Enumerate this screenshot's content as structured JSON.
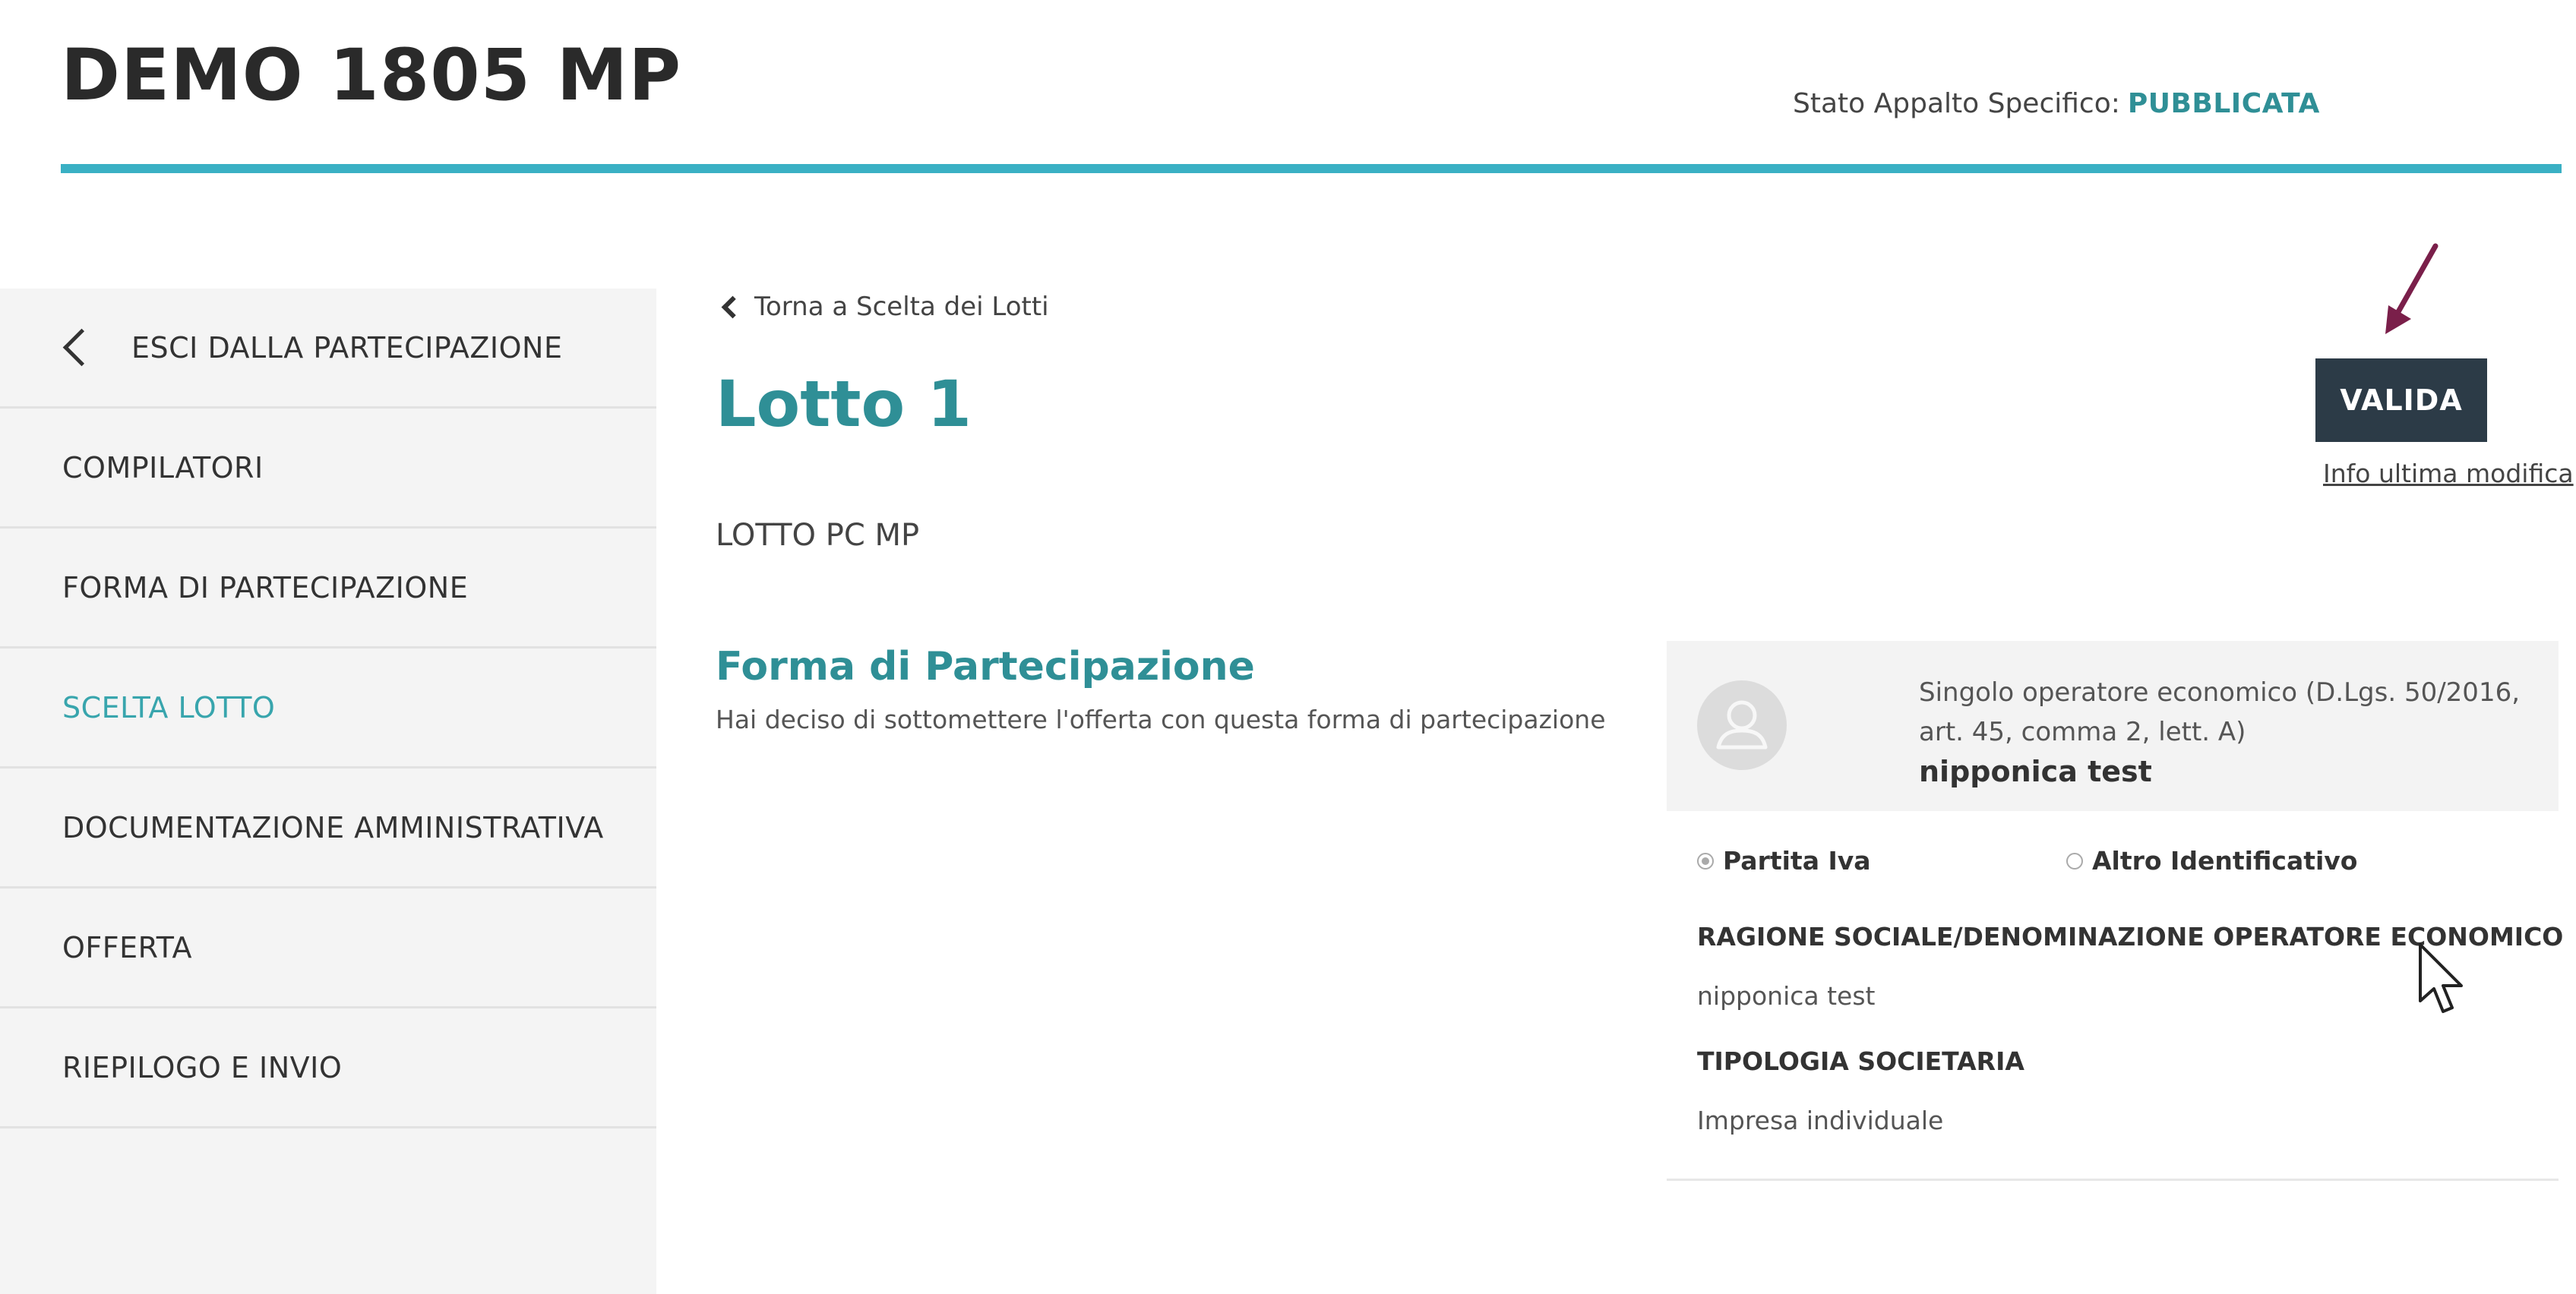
{
  "header": {
    "title": "DEMO 1805 MP",
    "status_label": "Stato Appalto Specifico:",
    "status_value": "PUBBLICATA"
  },
  "sidebar": {
    "exit_label": "ESCI DALLA PARTECIPAZIONE",
    "items": [
      {
        "label": "COMPILATORI"
      },
      {
        "label": "FORMA DI PARTECIPAZIONE"
      },
      {
        "label": "SCELTA LOTTO",
        "active": true
      },
      {
        "label": "DOCUMENTAZIONE AMMINISTRATIVA"
      },
      {
        "label": "OFFERTA"
      },
      {
        "label": "RIEPILOGO E INVIO"
      }
    ]
  },
  "main": {
    "back_link": "Torna a Scelta dei Lotti",
    "lot_title": "Lotto 1",
    "lot_description": "LOTTO PC MP",
    "section_title": "Forma di Partecipazione",
    "section_subtitle": "Hai deciso di sottomettere l'offerta con questa forma di partecipazione",
    "validate_label": "VALIDA",
    "info_link": "Info ultima modifica"
  },
  "card": {
    "operator_type": "Singolo operatore economico (D.Lgs. 50/2016, art. 45, comma 2, lett. A)",
    "operator_name": "nipponica test",
    "radio_options": [
      {
        "label": "Partita Iva",
        "checked": true
      },
      {
        "label": "Altro Identificativo",
        "checked": false
      }
    ],
    "fields": [
      {
        "label": "RAGIONE SOCIALE/DENOMINAZIONE OPERATORE ECONOMICO",
        "value": "nipponica test"
      },
      {
        "label": "TIPOLOGIA SOCIETARIA",
        "value": "Impresa individuale"
      }
    ]
  },
  "colors": {
    "accent": "#2f8f96",
    "header_rule": "#3ab0c4",
    "button_bg": "#2c3b47",
    "annotation_arrow": "#7a1f4a"
  },
  "icons": [
    "chevron-left-icon",
    "user-avatar-icon",
    "annotation-arrow-icon",
    "mouse-cursor-icon"
  ]
}
